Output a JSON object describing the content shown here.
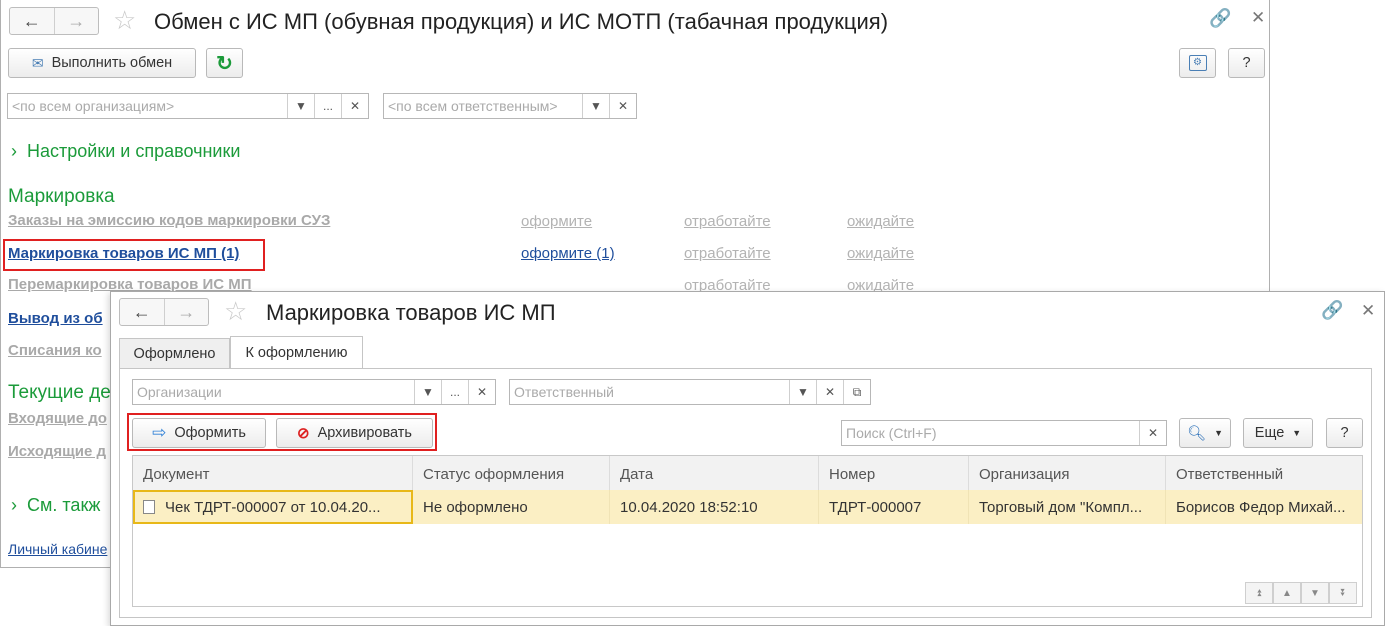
{
  "back_window": {
    "title": "Обмен с ИС МП (обувная продукция) и ИС МОТП (табачная продукция)",
    "exchange_button": "Выполнить обмен",
    "help_label": "?",
    "org_filter_placeholder": "<по всем организациям>",
    "resp_filter_placeholder": "<по всем ответственным>",
    "ellipsis": "...",
    "settings_section": "Настройки и справочники",
    "marking_section": "Маркировка",
    "rows": [
      {
        "label": "Заказы на эмиссию кодов маркировки СУЗ",
        "c1": "оформите",
        "c2": "отработайте",
        "c3": "ожидайте"
      },
      {
        "label": "Маркировка товаров ИС МП (1)",
        "c1": "оформите (1)",
        "c2": "отработайте",
        "c3": "ожидайте"
      },
      {
        "label": "Перемаркировка товаров ИС МП",
        "c1": "",
        "c2": "отработайте",
        "c3": "ожидайте"
      },
      {
        "label": "Вывод из об"
      },
      {
        "label": "Списания ко"
      }
    ],
    "current_section": "Текущие де",
    "incoming": "Входящие до",
    "outgoing": "Исходящие д",
    "see_also": "См. такж",
    "personal_cabinet": "Личный кабине"
  },
  "front_window": {
    "title": "Маркировка товаров ИС МП",
    "tabs": [
      "Оформлено",
      "К оформлению"
    ],
    "org_placeholder": "Организации",
    "resp_placeholder": "Ответственный",
    "ellipsis": "...",
    "issue_button": "Оформить",
    "archive_button": "Архивировать",
    "search_placeholder": "Поиск (Ctrl+F)",
    "more_button": "Еще",
    "help_label": "?",
    "columns": [
      "Документ",
      "Статус оформления",
      "Дата",
      "Номер",
      "Организация",
      "Ответственный"
    ],
    "rows": [
      {
        "document": "Чек ТДРТ-000007 от 10.04.20...",
        "status": "Не оформлено",
        "date": "10.04.2020 18:52:10",
        "number": "ТДРТ-000007",
        "org": "Торговый дом \"Компл...",
        "responsible": "Борисов Федор Михай..."
      }
    ]
  },
  "colors": {
    "accent_green": "#1b9b3a",
    "link_blue": "#1f4e9c",
    "highlight_red": "#e02020",
    "row_selected": "#fbefc4"
  }
}
